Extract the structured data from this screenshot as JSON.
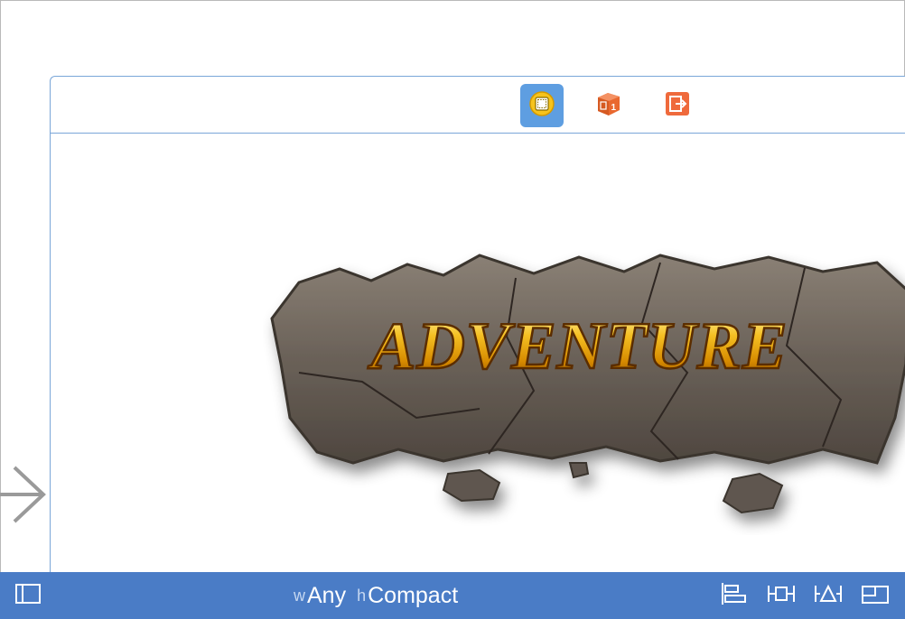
{
  "scene": {
    "dock_icons": [
      {
        "name": "view-controller-icon",
        "active": true
      },
      {
        "name": "first-responder-icon",
        "active": false
      },
      {
        "name": "exit-icon",
        "active": false
      }
    ],
    "logo_text": "ADVENTURE"
  },
  "bottom_bar": {
    "size_class": {
      "width_prefix": "w",
      "width_value": "Any",
      "height_prefix": "h",
      "height_value": "Compact"
    },
    "colors": {
      "bar": "#4a7cc6",
      "selection": "#5e9ee1",
      "scene_border": "#7aa6d8"
    }
  }
}
